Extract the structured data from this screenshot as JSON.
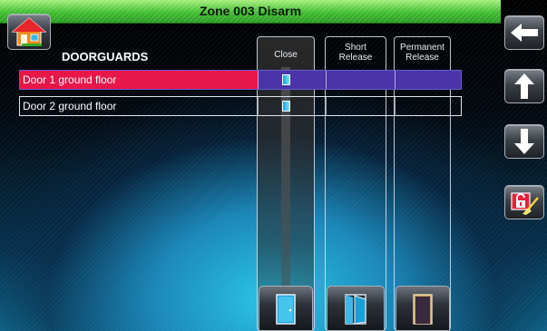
{
  "title": "Zone 003  Disarm",
  "list_title": "DOORGUARDS",
  "columns": {
    "close": "Close",
    "short": "Short\nRelease",
    "permanent": "Permanent\nRelease"
  },
  "rows": [
    {
      "name": "Door 1 ground floor",
      "selected": true
    },
    {
      "name": "Door 2 ground floor",
      "selected": false
    }
  ],
  "icons": {
    "home": "home-icon",
    "back": "arrow-left-icon",
    "up": "arrow-up-icon",
    "down": "arrow-down-icon",
    "unlock": "lock-broom-icon",
    "door_closed": "door-closed-icon",
    "door_open": "door-open-icon",
    "door_permanent": "door-permanent-icon"
  },
  "colors": {
    "title_bar": "#3fbd2f",
    "selected_row": "#e8174a",
    "selected_row_cells": "#4a34a8"
  }
}
